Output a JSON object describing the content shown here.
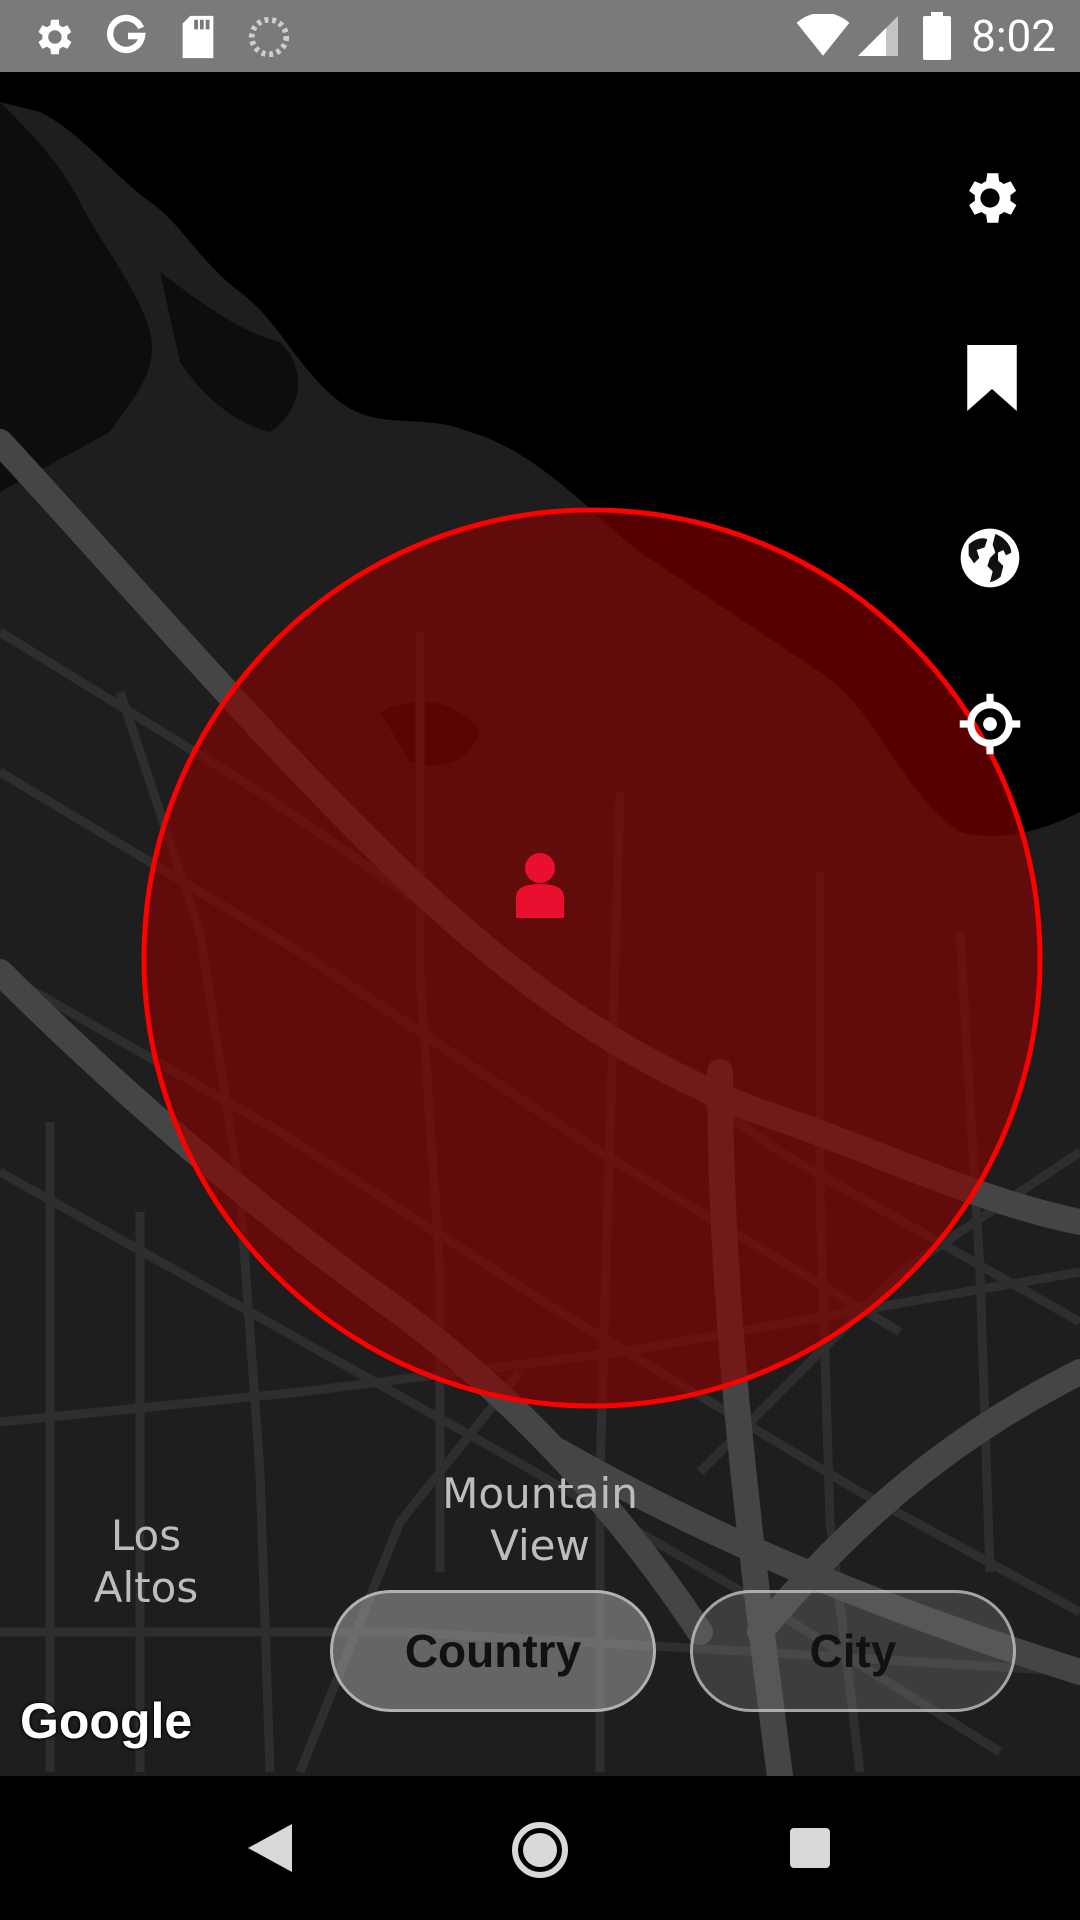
{
  "status_bar": {
    "time": "8:02",
    "left_icons": [
      "settings-icon",
      "google-icon",
      "sd-card-icon",
      "loading-icon"
    ],
    "right_icons": [
      "wifi-icon",
      "signal-icon",
      "battery-icon"
    ]
  },
  "map": {
    "labels": {
      "los_altos": "Los Altos",
      "mountain_view_line1": "Mountain",
      "mountain_view_line2": "View"
    },
    "attribution": "Google",
    "radius_color": "#ff0000",
    "radius_fill": "#6a0000"
  },
  "side_buttons": [
    "gear-icon",
    "bookmark-icon",
    "globe-icon",
    "crosshair-icon"
  ],
  "buttons": {
    "country": "Country",
    "city": "City"
  },
  "nav_bar": [
    "back-icon",
    "home-icon",
    "recents-icon"
  ],
  "colors": {
    "status_bar": "#7a7a7a",
    "user_marker": "#e8102e"
  }
}
